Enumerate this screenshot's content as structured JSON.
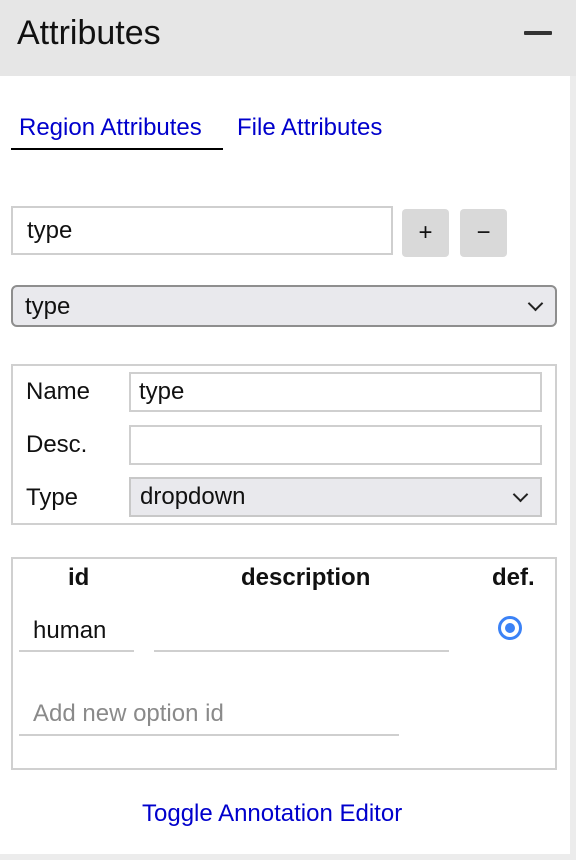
{
  "header": {
    "title": "Attributes",
    "collapse_icon": "minus-icon"
  },
  "tabs": [
    {
      "label": "Region Attributes",
      "active": true
    },
    {
      "label": "File Attributes",
      "active": false
    }
  ],
  "attribute_input": {
    "value": "type"
  },
  "buttons": {
    "add_label": "+",
    "remove_label": "−"
  },
  "attribute_select": {
    "value": "type"
  },
  "properties": {
    "name_label": "Name",
    "name_value": "type",
    "desc_label": "Desc.",
    "desc_value": "",
    "type_label": "Type",
    "type_value": "dropdown"
  },
  "options_table": {
    "headers": {
      "id": "id",
      "description": "description",
      "default": "def."
    },
    "rows": [
      {
        "id": "human",
        "description": "",
        "default": true
      }
    ],
    "new_option_placeholder": "Add new option id"
  },
  "footer": {
    "toggle_label": "Toggle Annotation Editor"
  },
  "colors": {
    "link": "#0000cc",
    "radio_accent": "#3b82f6",
    "header_bg": "#e6e6e6"
  }
}
